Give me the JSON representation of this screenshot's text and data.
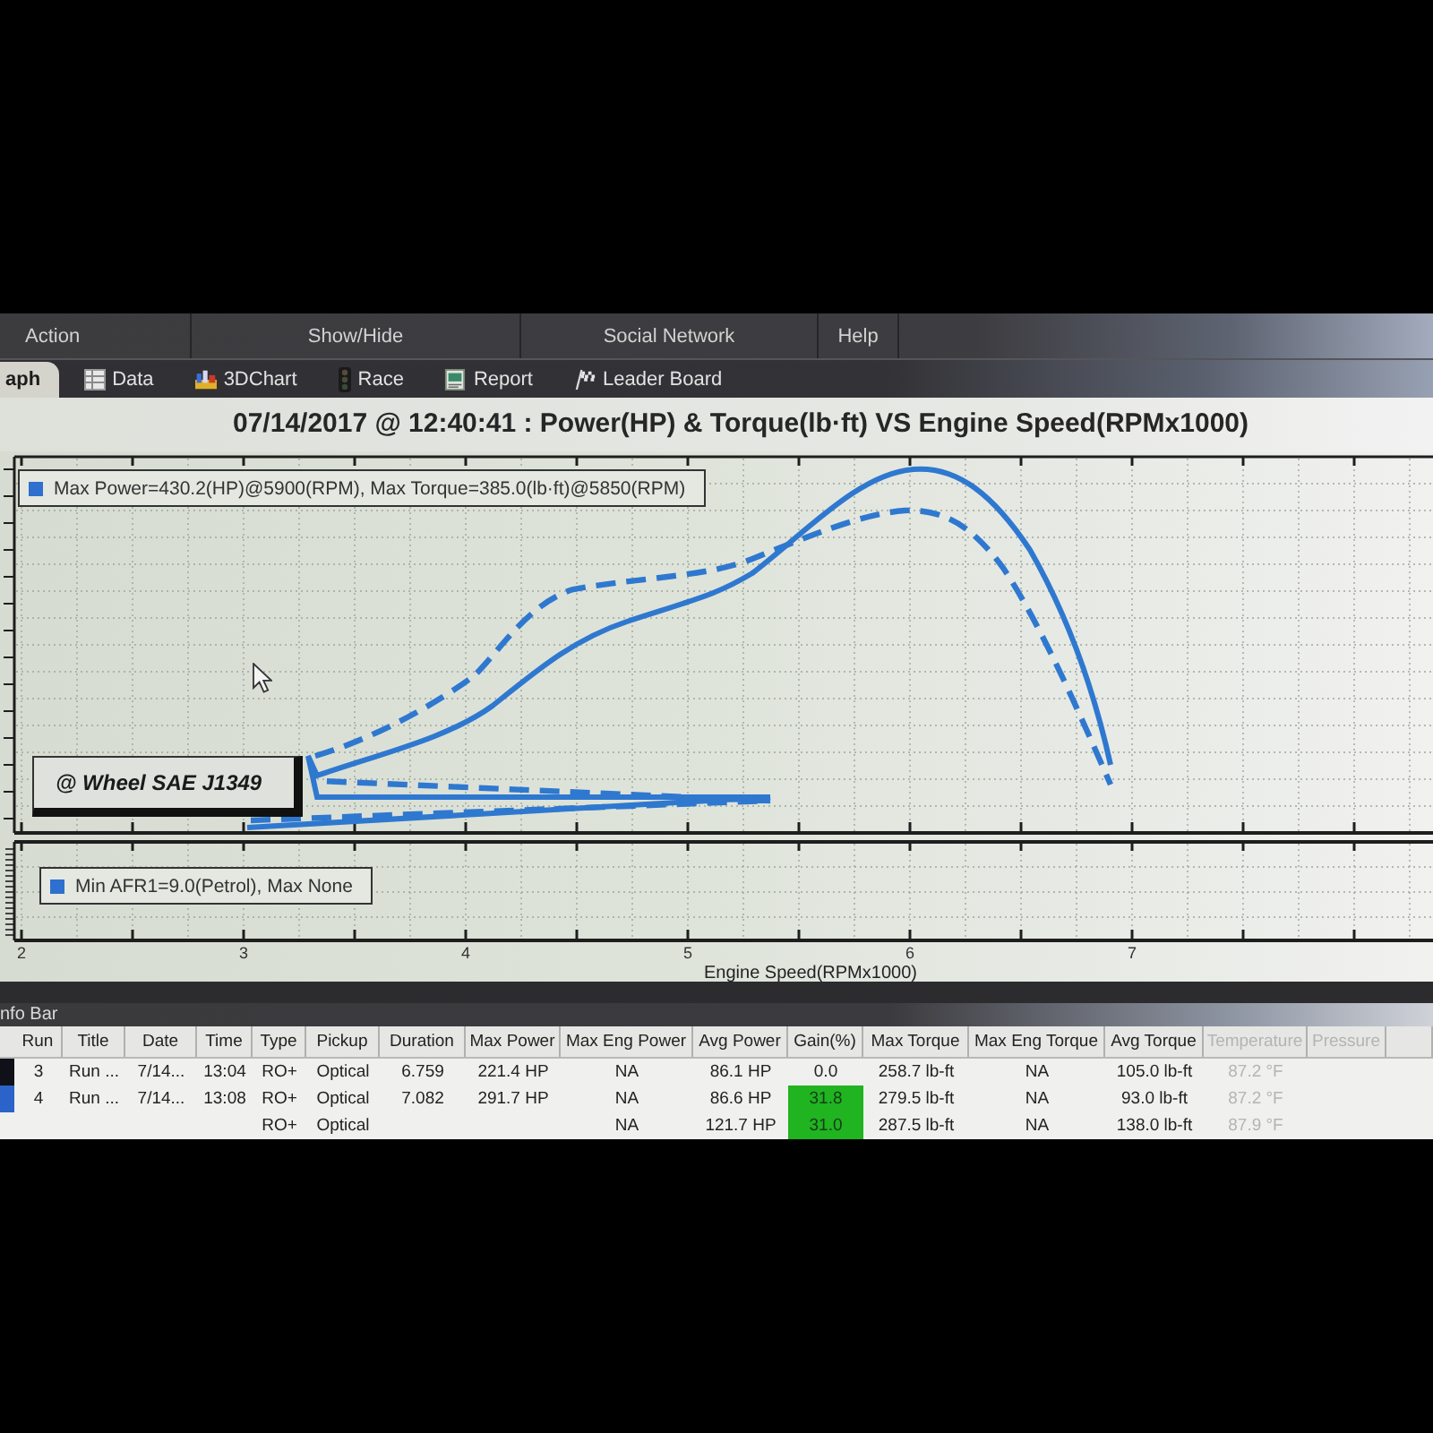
{
  "menu_bar": {
    "items": [
      {
        "label": "Action"
      },
      {
        "label": "Show/Hide"
      },
      {
        "label": "Social Network"
      },
      {
        "label": "Help"
      }
    ]
  },
  "tabs": [
    {
      "label": "aph",
      "selected": true
    },
    {
      "label": "Data",
      "selected": false
    },
    {
      "label": "3DChart",
      "selected": false
    },
    {
      "label": "Race",
      "selected": false
    },
    {
      "label": "Report",
      "selected": false
    },
    {
      "label": "Leader Board",
      "selected": false
    }
  ],
  "chart": {
    "title": "07/14/2017 @ 12:40:41 : Power(HP) & Torque(lb·ft) VS Engine Speed(RPMx1000)",
    "legend": "Max Power=430.2(HP)@5900(RPM), Max Torque=385.0(lb·ft)@5850(RPM)",
    "standard_label": "@ Wheel SAE J1349",
    "afr_legend": "Min AFR1=9.0(Petrol), Max None",
    "x_tick_labels": [
      "2",
      "3",
      "4",
      "5",
      "6",
      "7"
    ],
    "xlabel": "Engine Speed(RPMx1000)"
  },
  "info_bar": {
    "title": "nfo Bar"
  },
  "table": {
    "columns": [
      "Run",
      "Title",
      "Date",
      "Time",
      "Type",
      "Pickup",
      "Duration",
      "Max Power",
      "Max Eng Power",
      "Avg Power",
      "Gain(%)",
      "Max Torque",
      "Max Eng Torque",
      "Avg Torque",
      "Temperature",
      "Pressure"
    ],
    "rows": [
      {
        "color": "#101018",
        "gain_highlighted": false,
        "cells": [
          "3",
          "Run ...",
          "7/14...",
          "13:04",
          "RO+",
          "Optical",
          "6.759",
          "221.4 HP",
          "NA",
          "86.1 HP",
          "0.0",
          "258.7 lb-ft",
          "NA",
          "105.0 lb-ft",
          "87.2 °F"
        ]
      },
      {
        "color": "#2b63c9",
        "gain_highlighted": true,
        "cells": [
          "4",
          "Run ...",
          "7/14...",
          "13:08",
          "RO+",
          "Optical",
          "7.082",
          "291.7 HP",
          "NA",
          "86.6 HP",
          "31.8",
          "279.5 lb-ft",
          "NA",
          "93.0 lb-ft",
          "87.2 °F"
        ]
      },
      {
        "gain_highlighted": true,
        "cells": [
          null,
          null,
          null,
          null,
          "RO+",
          "Optical",
          null,
          null,
          "NA",
          "121.7 HP",
          "31.0",
          "287.5 lb-ft",
          "NA",
          "138.0 lb-ft",
          "87.9 °F"
        ]
      }
    ]
  }
}
